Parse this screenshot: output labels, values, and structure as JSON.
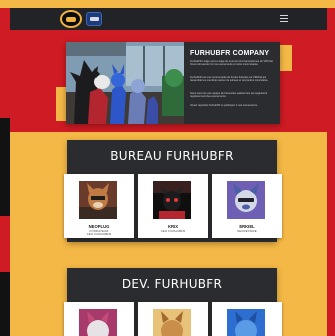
{
  "header": {
    "logo_alt": "furhubfr-logo",
    "secondary_logo_alt": "partner-logo",
    "menu_icon": "hamburger-menu-icon"
  },
  "hero": {
    "title": "FURHUBFR COMPANY",
    "paragraphs": [
      "FurhubFR Lodge est la Lodge de tous les furs francophones de VRChat. Vous retrouverez ici nos evenements et notre communaute.",
      "FurhubFR est une communaute de furries francais sur VRChat qui rassemble les membres autour de soirees et rencontres conviviales.",
      "Nous sommes une equipe de benevoles passionnes qui organisent regulierement des evenements.",
      "Venez rejoindre FurhubFR et participez a nos evenements."
    ]
  },
  "sections": [
    {
      "title": "BUREAU FURHUBFR",
      "members": [
        {
          "name": "NEOPLUG",
          "role": "FONDATEUR\nCEO FURHUBFR"
        },
        {
          "name": "KRIX",
          "role": "CEO FURHUBFR"
        },
        {
          "name": "ERKIEL",
          "role": "SECRETAIRE"
        }
      ]
    },
    {
      "title": "DEV. FURHUBFR",
      "members": [
        {
          "name": "",
          "role": ""
        },
        {
          "name": "",
          "role": ""
        },
        {
          "name": "",
          "role": ""
        }
      ]
    }
  ],
  "colors": {
    "brand_red": "#cf1b24",
    "brand_yellow": "#f4b846",
    "card_dark": "#2b2c2f"
  }
}
